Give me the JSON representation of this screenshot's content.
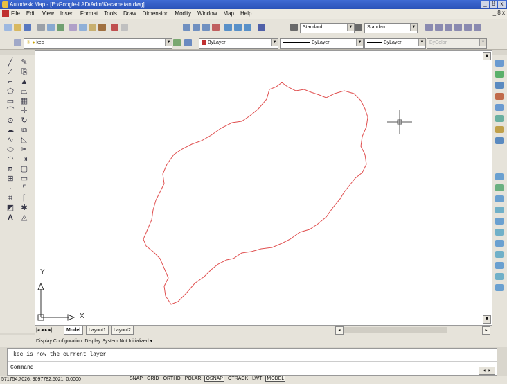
{
  "window": {
    "title": "Autodesk Map - [E:\\Google-LAD\\Adm\\Kecamatan.dwg]",
    "controls": {
      "minimize": "_",
      "restore": "ȣ",
      "close": "x"
    }
  },
  "menubar": {
    "items": [
      "File",
      "Edit",
      "View",
      "Insert",
      "Format",
      "Tools",
      "Draw",
      "Dimension",
      "Modify",
      "Window",
      "Map",
      "Help"
    ]
  },
  "toolbar_standard": {
    "text_style": "Standard",
    "dim_style": "Standard"
  },
  "toolbar_layers": {
    "layer": "kec",
    "color": "ByLayer",
    "linetype": "ByLayer",
    "lineweight": "ByLayer",
    "plotstyle": "ByColor"
  },
  "ucs": {
    "y_label": "Y",
    "x_label": "X"
  },
  "layout_tabs": {
    "model": "Model",
    "layout1": "Layout1",
    "layout2": "Layout2",
    "nav": [
      "|◂",
      "◂",
      "▸",
      "▸|"
    ]
  },
  "display_config": {
    "text": "Display Configuration:  Display System Not Initialized"
  },
  "command": {
    "history": "kec is now the current layer",
    "prompt": "Command"
  },
  "status": {
    "coords": "571754.7026, 9097782.5021, 0.0000",
    "modes": [
      {
        "label": "SNAP",
        "on": false
      },
      {
        "label": "GRID",
        "on": false
      },
      {
        "label": "ORTHO",
        "on": false
      },
      {
        "label": "POLAR",
        "on": false
      },
      {
        "label": "OSNAP",
        "on": true
      },
      {
        "label": "OTRACK",
        "on": false
      },
      {
        "label": "LWT",
        "on": false
      },
      {
        "label": "MODEL",
        "on": true
      }
    ]
  },
  "colors": {
    "drawing_line": "#e05050",
    "canvas": "#ffffff",
    "title_bar": "#2a52b8"
  }
}
